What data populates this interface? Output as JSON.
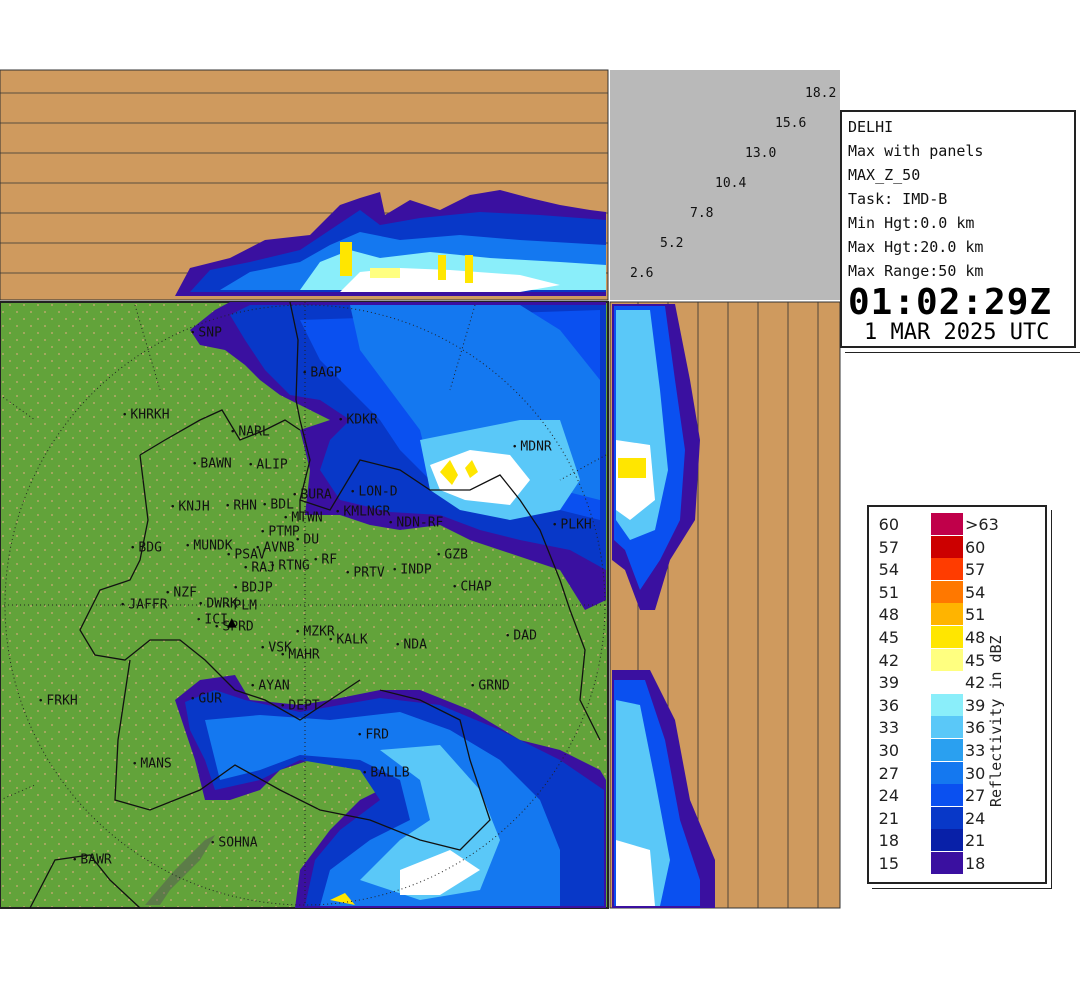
{
  "info_panel": {
    "station": "DELHI",
    "product": "Max with panels",
    "product_id": "MAX_Z_50",
    "task": "Task: IMD-B",
    "min_height": "Min Hgt:0.0 km",
    "max_height": "Max Hgt:20.0 km",
    "max_range": "Max Range:50 km",
    "time": "01:02:29Z",
    "date": "1 MAR 2025 UTC"
  },
  "height_scale": [
    "18.2",
    "15.6",
    "13.0",
    "10.4",
    "7.8",
    "5.2",
    "2.6"
  ],
  "legend": {
    "title": "Reflectivity in dBZ",
    "bins": [
      {
        "lo": "60",
        "hi": ">63",
        "color": "#c0004a"
      },
      {
        "lo": "57",
        "hi": "60",
        "color": "#cc0000"
      },
      {
        "lo": "54",
        "hi": "57",
        "color": "#ff3c00"
      },
      {
        "lo": "51",
        "hi": "54",
        "color": "#ff7800"
      },
      {
        "lo": "48",
        "hi": "51",
        "color": "#ffb400"
      },
      {
        "lo": "45",
        "hi": "48",
        "color": "#ffe600"
      },
      {
        "lo": "42",
        "hi": "45",
        "color": "#ffff80"
      },
      {
        "lo": "39",
        "hi": "42",
        "color": "#ffffff"
      },
      {
        "lo": "36",
        "hi": "39",
        "color": "#8aeefa"
      },
      {
        "lo": "33",
        "hi": "36",
        "color": "#5ac8f8"
      },
      {
        "lo": "30",
        "hi": "33",
        "color": "#2aa0f0"
      },
      {
        "lo": "27",
        "hi": "30",
        "color": "#1478f0"
      },
      {
        "lo": "24",
        "hi": "27",
        "color": "#0a50f0"
      },
      {
        "lo": "21",
        "hi": "24",
        "color": "#0838c8"
      },
      {
        "lo": "18",
        "hi": "21",
        "color": "#0820a8"
      },
      {
        "lo": "15",
        "hi": "18",
        "color": "#3a10a0"
      }
    ]
  },
  "colors": {
    "terrain": "#62a33a",
    "panel_background": "#cf9a5e",
    "corner_gray": "#b9b9b9"
  },
  "stations": [
    "SNP",
    "BAGP",
    "KHRKH",
    "NARL",
    "KDKR",
    "MDNR",
    "BAWN",
    "ALIP",
    "BURA",
    "LON-D",
    "KNJH",
    "RHN",
    "BDL",
    "KMLNGR",
    "NDN-RF",
    "PLKH",
    "MTWN",
    "PTMP",
    "DU",
    "BDG",
    "MUNDK",
    "PSAV",
    "AVNB",
    "GZB",
    "RTNG",
    "RF",
    "RAJ",
    "PRTV",
    "INDP",
    "CHAP",
    "BDJP",
    "NZF",
    "JAFFR",
    "DWRK",
    "PLM",
    "ICI",
    "SPRD",
    "DAD",
    "NDA",
    "VSK",
    "MZKR",
    "KALK",
    "MAHR",
    "AYAN",
    "GUR",
    "FRKH",
    "DEPT",
    "GRND",
    "FRD",
    "MANS",
    "BALLB",
    "SOHNA",
    "BAWR"
  ]
}
